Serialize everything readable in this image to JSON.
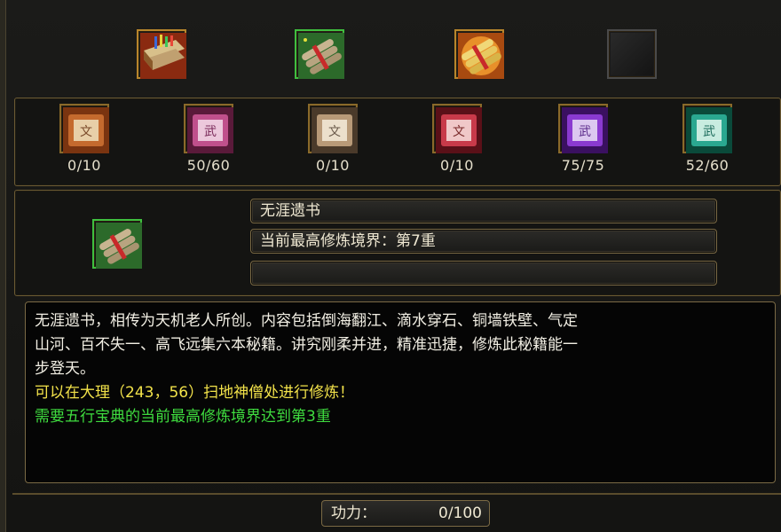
{
  "top_icons": [
    {
      "name": "book-stack-icon",
      "border": "#b8862c"
    },
    {
      "name": "scroll-bundle-icon",
      "border": "#3fbf3f"
    },
    {
      "name": "golden-scroll-bundle-icon",
      "border": "#b8862c"
    },
    {
      "name": "empty-slot-icon",
      "border": "#4a4a4a"
    }
  ],
  "scrolls": [
    {
      "icon": "scroll-orange-icon",
      "color": "#c46a2e",
      "count": "0/10"
    },
    {
      "icon": "scroll-pink-icon",
      "color": "#c0508c",
      "count": "50/60"
    },
    {
      "icon": "scroll-beige-icon",
      "color": "#b89a78",
      "count": "0/10"
    },
    {
      "icon": "scroll-red-icon",
      "color": "#c83a4a",
      "count": "0/10"
    },
    {
      "icon": "scroll-purple-icon",
      "color": "#8a3ad0",
      "count": "75/75"
    },
    {
      "icon": "scroll-teal-icon",
      "color": "#2aa890",
      "count": "52/60"
    }
  ],
  "selected": {
    "icon": "scroll-bundle-icon",
    "name": "无涯遗书",
    "realm": "当前最高修炼境界：第7重",
    "extra": ""
  },
  "description": {
    "line1": "无涯遗书，相传为天机老人所创。内容包括倒海翻江、滴水穿石、铜墙铁壁、气定",
    "line2": "山河、百不失一、高飞远集六本秘籍。讲究刚柔并进，精准迅捷，修炼此秘籍能一",
    "line3": "步登天。",
    "location": "可以在大理（243，56）扫地神僧处进行修炼！",
    "requirement": "需要五行宝典的当前最高修炼境界达到第3重"
  },
  "power": {
    "label": "功力：",
    "value": "0/100"
  }
}
